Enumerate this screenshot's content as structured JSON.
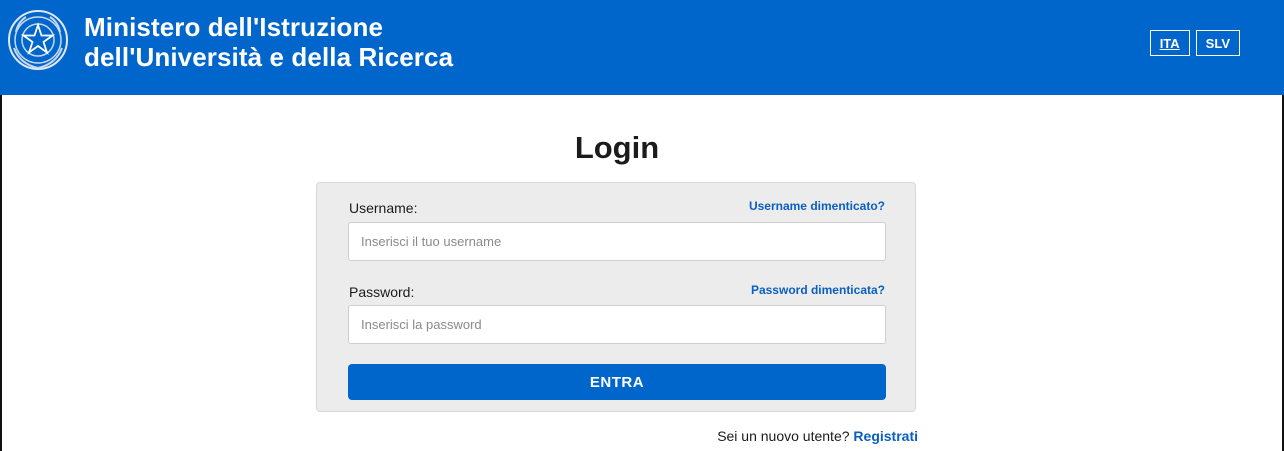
{
  "header": {
    "title_line1": "Ministero dell'Istruzione",
    "title_line2": "dell'Università e della Ricerca",
    "background_color": "#0066cc",
    "emblem_icon": "italian-republic-emblem-icon",
    "languages": [
      {
        "label": "ITA",
        "active": true
      },
      {
        "label": "SLV",
        "active": false
      }
    ]
  },
  "login": {
    "title": "Login",
    "username": {
      "label": "Username:",
      "forgot_link": "Username dimenticato?",
      "placeholder": "Inserisci il tuo username",
      "value": ""
    },
    "password": {
      "label": "Password:",
      "forgot_link": "Password dimenticata?",
      "placeholder": "Inserisci la password",
      "value": ""
    },
    "submit_label": "ENTRA"
  },
  "register": {
    "prompt": "Sei un nuovo utente?",
    "link": "Registrati"
  },
  "colors": {
    "primary": "#0066cc",
    "link": "#0a5fbf",
    "card_background": "#ececec"
  }
}
